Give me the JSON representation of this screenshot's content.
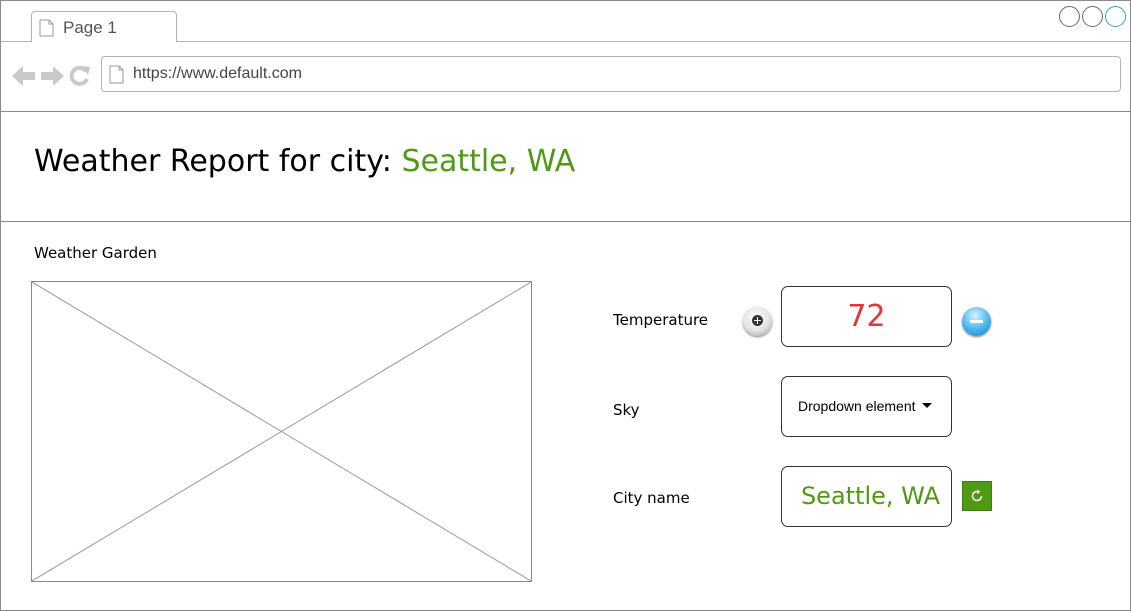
{
  "browser": {
    "tab_label": "Page 1",
    "url": "https://www.default.com",
    "window_buttons": [
      "minimize-icon",
      "maximize-icon",
      "close-icon"
    ],
    "nav_icons": [
      "back-arrow-icon",
      "forward-arrow-icon",
      "reload-icon"
    ]
  },
  "header": {
    "title_prefix": "Weather Report for city: ",
    "title_city": "Seattle, WA"
  },
  "garden": {
    "label": "Weather Garden",
    "image": "image-placeholder-icon"
  },
  "form": {
    "temperature": {
      "label": "Temperature",
      "value": "72",
      "increment_icon": "plus-icon",
      "decrement_icon": "minus-icon"
    },
    "sky": {
      "label": "Sky",
      "dropdown_value": "Dropdown element"
    },
    "city": {
      "label": "City name",
      "value": "Seattle, WA",
      "refresh_icon": "refresh-icon"
    }
  },
  "colors": {
    "accent_green": "#4f9a12",
    "temperature_red": "#e8323a",
    "minus_blue": "#45b4ec"
  }
}
